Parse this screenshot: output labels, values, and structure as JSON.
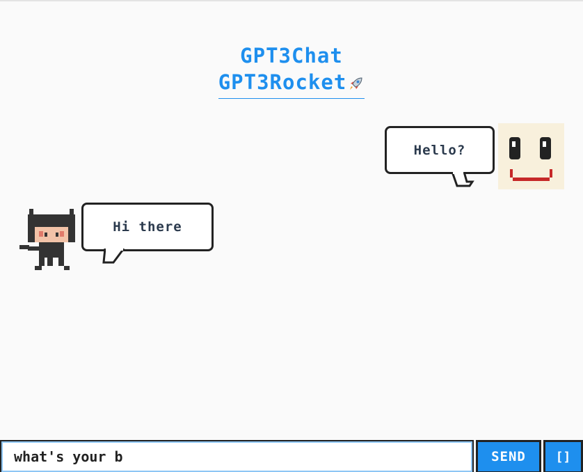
{
  "header": {
    "title": "GPT3Chat",
    "link_text": "GPT3Rocket",
    "link_icon": "rocket-icon",
    "accent_color": "#1e8fee"
  },
  "messages": [
    {
      "from": "user",
      "text": "Hello?"
    },
    {
      "from": "bot",
      "text": "Hi there"
    }
  ],
  "composer": {
    "input_value": "what's your b",
    "send_label": "SEND",
    "mic_label": "[]"
  }
}
